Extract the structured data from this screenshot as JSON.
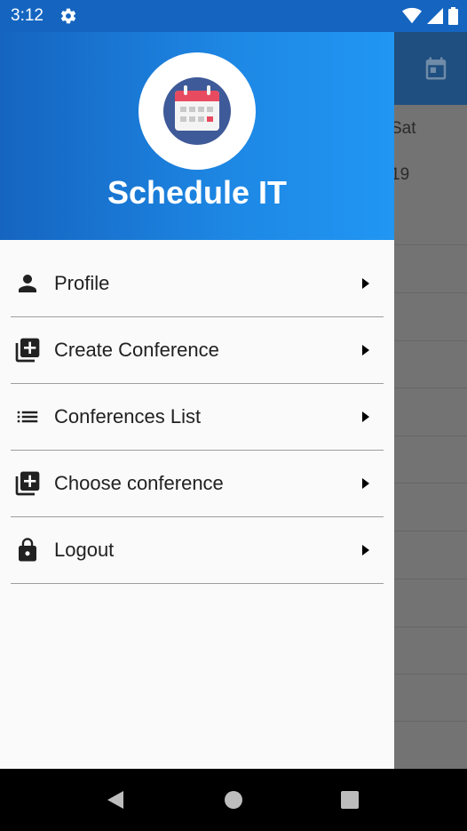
{
  "status_bar": {
    "time": "3:12",
    "icons": [
      "settings-icon",
      "wifi-icon",
      "signal-icon",
      "battery-icon"
    ]
  },
  "background": {
    "day_label": "Sat",
    "date_label": "19",
    "icons": [
      "calendar-icon"
    ]
  },
  "drawer": {
    "app_title": "Schedule IT",
    "logo_icon": "calendar-logo-icon",
    "menu": [
      {
        "label": "Profile",
        "icon": "person-icon"
      },
      {
        "label": "Create Conference",
        "icon": "add-box-icon"
      },
      {
        "label": "Conferences List",
        "icon": "list-icon"
      },
      {
        "label": "Choose conference",
        "icon": "add-box-icon"
      },
      {
        "label": "Logout",
        "icon": "lock-icon"
      }
    ]
  },
  "nav_bar": {
    "icons": [
      "back-icon",
      "home-icon",
      "recents-icon"
    ]
  },
  "colors": {
    "primary": "#1565c0",
    "accent": "#2196f3",
    "drawer_bg": "#fafafa",
    "text": "#212121"
  }
}
